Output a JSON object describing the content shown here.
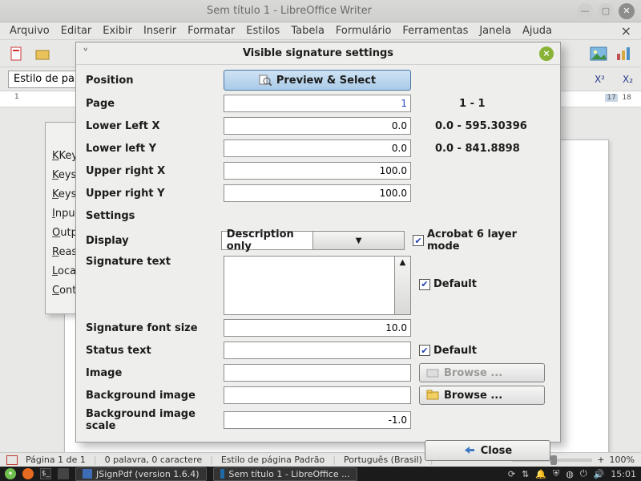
{
  "window": {
    "title": "Sem título 1 - LibreOffice Writer",
    "min": "—",
    "max": "▢",
    "close": "✕"
  },
  "menu": {
    "arquivo": "Arquivo",
    "editar": "Editar",
    "exibir": "Exibir",
    "inserir": "Inserir",
    "formatar": "Formatar",
    "estilos": "Estilos",
    "tabela": "Tabela",
    "formulario": "Formulário",
    "ferramentas": "Ferramentas",
    "janela": "Janela",
    "ajuda": "Ajuda",
    "tab_close": "×"
  },
  "toolbar2": {
    "para_style": "Estilo de pará",
    "sup": "X²",
    "sub": "X₂"
  },
  "ruler": {
    "left": "1",
    "right_17": "17",
    "right_18": "18"
  },
  "under": {
    "keys1": "Keys",
    "keys2": "Keys",
    "keys3": "Keys",
    "input": "Input",
    "output": "Outp",
    "reason": "Reas",
    "location": "Loca",
    "contact": "Cont"
  },
  "dialog": {
    "title": "Visible signature settings",
    "back": "˅",
    "position": "Position",
    "preview_btn": "Preview & Select",
    "page_lbl": "Page",
    "page_val": "1",
    "page_range": "1 - 1",
    "llx_lbl": "Lower Left X",
    "llx_val": "0.0",
    "llx_range": "0.0 - 595.30396",
    "lly_lbl": "Lower left Y",
    "lly_val": "0.0",
    "lly_range": "0.0 - 841.8898",
    "urx_lbl": "Upper right X",
    "urx_val": "100.0",
    "ury_lbl": "Upper right Y",
    "ury_val": "100.0",
    "settings": "Settings",
    "display_lbl": "Display",
    "display_val": "Description only",
    "acrobat6": "Acrobat 6 layer mode",
    "sigtext_lbl": "Signature text",
    "default1": "Default",
    "fontsize_lbl": "Signature font size",
    "fontsize_val": "10.0",
    "status_lbl": "Status text",
    "status_val": "",
    "default2": "Default",
    "image_lbl": "Image",
    "image_val": "",
    "browse1": "Browse ...",
    "bgimage_lbl": "Background image",
    "bgimage_val": "",
    "browse2": "Browse ...",
    "bgscale_lbl": "Background image scale",
    "bgscale_val": "-1.0",
    "close": "Close"
  },
  "status": {
    "page": "Página 1 de 1",
    "words": "0 palavra, 0 caractere",
    "style": "Estilo de página Padrão",
    "lang": "Português (Brasil)",
    "zoom_minus": "−",
    "zoom_plus": "+",
    "zoom": "100%"
  },
  "taskbar": {
    "app1": "JSignPdf (version 1.6.4)",
    "app2": "Sem título 1 - LibreOffice ...",
    "clock": "15:01"
  }
}
